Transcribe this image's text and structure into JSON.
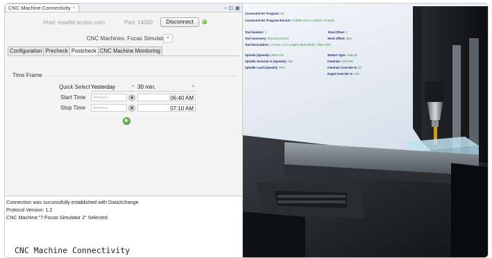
{
  "window": {
    "tab_title": "CNC Machine Connectivity",
    "tab_close": "×",
    "controls": "– ⊡ ▣"
  },
  "connection": {
    "host_label": "Host: reseller.scytec.com",
    "port_label": "Port: 14002",
    "disconnect_label": "Disconnect",
    "status_color": "#3a9a10"
  },
  "machine": {
    "label": "CNC Machines: Focas Simulator 2",
    "arrow": "▾"
  },
  "tabs": [
    {
      "label": "Configuration"
    },
    {
      "label": "Precheck"
    },
    {
      "label": "Postcheck"
    },
    {
      "label": "CNC Machine Monitoring"
    }
  ],
  "time_frame": {
    "group_label": "Time Frame",
    "quick_select_label": "Quick Select",
    "quick_select_value": "Yesterday",
    "interval_value": "30 min.",
    "start_label": "Start Time",
    "start_date_placeholder": "d/m/yyyy",
    "start_time": "06:40 AM",
    "stop_label": "Stop Time",
    "stop_date_placeholder": "d/m/yyyy",
    "stop_time": "07:10 AM",
    "calendar_glyph": "▣",
    "go_glyph": "▶",
    "arrow": "▾"
  },
  "log": [
    "Connection was successfully established with DataXchange",
    "Protocol Version: 1.2",
    "CNC Machine:\"7:Focas Simulator 2\" Selected"
  ],
  "caption": "CNC Machine Connectivity",
  "viewer": {
    "lines": [
      {
        "label": "Connected NC Program:",
        "value": "O1"
      },
      {
        "label": "Connected NC Program Record:",
        "value": "G10000 G21 X-3.2610 Y-3.2610"
      },
      {
        "label": "Tool Number:",
        "value": "1"
      },
      {
        "label": "Tool Geometry:",
        "value": "Flat End (1.5 D)"
      },
      {
        "label": "Tool Description:",
        "value": "1.5 Dia. x 2.5 Length Flat Endmill, 4 flute HSS"
      },
      {
        "label": "Spindle (Speeds):",
        "value": "2600.CW"
      },
      {
        "label": "Spindle Override % (Speeds):",
        "value": "100"
      },
      {
        "label": "Spindle Load (Speeds):",
        "value": "RN1"
      },
      {
        "label": "Total Offset:",
        "value": "1"
      },
      {
        "label": "Work Offset:",
        "value": "G54"
      },
      {
        "label": "Motion Type:",
        "value": "LINEAR"
      },
      {
        "label": "Feedrate:",
        "value": "100 IPM"
      },
      {
        "label": "Feedrate Override %:",
        "value": "97"
      },
      {
        "label": "Rapid Override %:",
        "value": "100"
      }
    ],
    "colors": {
      "label": "#1c2b70",
      "value": "#2f8a2f"
    }
  }
}
